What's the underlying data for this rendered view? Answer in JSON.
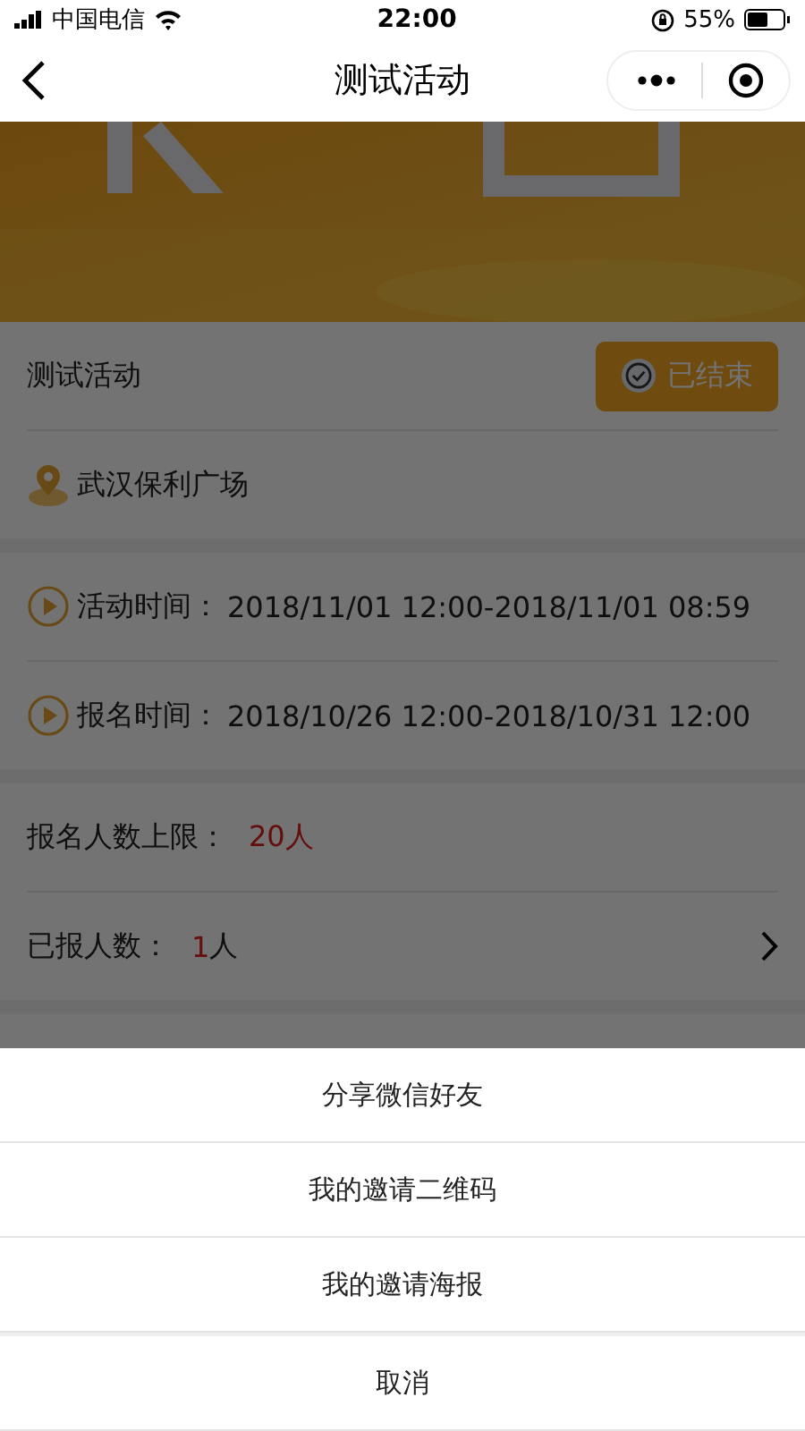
{
  "status_bar": {
    "carrier": "中国电信",
    "time": "22:00",
    "battery": "55%"
  },
  "nav_bar": {
    "title": "测试活动"
  },
  "event": {
    "title": "测试活动",
    "status_badge": "已结束",
    "location": "武汉保利广场"
  },
  "times": [
    {
      "label": "活动时间：",
      "value": "2018/11/01 12:00-2018/11/01 08:59"
    },
    {
      "label": "报名时间：",
      "value": "2018/10/26 12:00-2018/10/31 12:00"
    }
  ],
  "registration": [
    {
      "label": "报名人数上限：",
      "value": "20人",
      "has_arrow": false
    },
    {
      "label": "已报人数：",
      "value": "1",
      "unit": "人",
      "has_arrow": true
    }
  ],
  "action_sheet": {
    "options": [
      "分享微信好友",
      "我的邀请二维码",
      "我的邀请海报"
    ],
    "cancel": "取消"
  }
}
